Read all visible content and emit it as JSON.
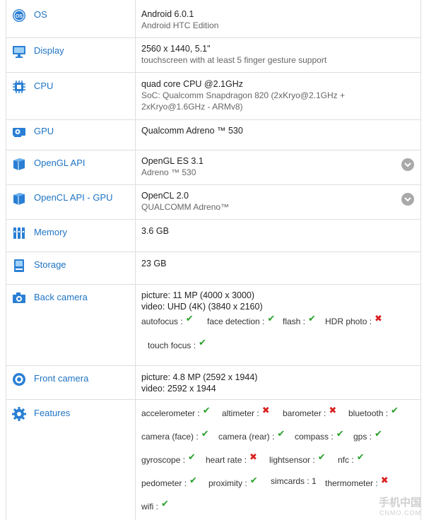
{
  "rows": {
    "os": {
      "label": "OS",
      "line1": "Android 6.0.1",
      "line2": "Android HTC Edition"
    },
    "display": {
      "label": "Display",
      "line1": "2560 x 1440, 5.1\"",
      "line2": "touchscreen with at least 5 finger gesture support"
    },
    "cpu": {
      "label": "CPU",
      "line1": "quad core CPU @2.1GHz",
      "line2": "SoC: Qualcomm Snapdragon 820 (2xKryo@2.1GHz + 2xKryo@1.6GHz - ARMv8)"
    },
    "gpu": {
      "label": "GPU",
      "line1": "Qualcomm Adreno ™ 530"
    },
    "opengl": {
      "label": "OpenGL API",
      "line1": "OpenGL ES 3.1",
      "line2": "Adreno ™ 530"
    },
    "opencl": {
      "label": "OpenCL API - GPU",
      "line1": "OpenCL 2.0",
      "line2": "QUALCOMM Adreno™"
    },
    "memory": {
      "label": "Memory",
      "line1": "3.6 GB"
    },
    "storage": {
      "label": "Storage",
      "line1": "23 GB"
    },
    "back_camera": {
      "label": "Back camera",
      "line1": "picture: 11 MP (4000 x 3000)",
      "line2": "video: UHD (4K) (3840 x 2160)",
      "features": [
        {
          "name": "autofocus :",
          "supported": "yes"
        },
        {
          "name": "face detection :",
          "supported": "yes"
        },
        {
          "name": "flash :",
          "supported": "yes"
        },
        {
          "name": "HDR photo :",
          "supported": "no"
        },
        {
          "name": "touch focus :",
          "supported": "yes"
        }
      ]
    },
    "front_camera": {
      "label": "Front camera",
      "line1": "picture: 4.8 MP (2592 x 1944)",
      "line2": "video: 2592 x 1944"
    },
    "features": {
      "label": "Features",
      "items": [
        {
          "name": "accelerometer :",
          "supported": "yes"
        },
        {
          "name": "altimeter :",
          "supported": "no"
        },
        {
          "name": "barometer :",
          "supported": "no"
        },
        {
          "name": "bluetooth :",
          "supported": "yes"
        },
        {
          "name": "camera (face) :",
          "supported": "yes"
        },
        {
          "name": "camera (rear) :",
          "supported": "yes"
        },
        {
          "name": "compass :",
          "supported": "yes"
        },
        {
          "name": "gps :",
          "supported": "yes"
        },
        {
          "name": "gyroscope :",
          "supported": "yes"
        },
        {
          "name": "heart rate :",
          "supported": "no"
        },
        {
          "name": "lightsensor :",
          "supported": "yes"
        },
        {
          "name": "nfc :",
          "supported": "yes"
        },
        {
          "name": "pedometer :",
          "supported": "yes"
        },
        {
          "name": "proximity :",
          "supported": "yes"
        },
        {
          "name": "simcards : 1"
        },
        {
          "name": "thermometer :",
          "supported": "no"
        },
        {
          "name": "wifi :",
          "supported": "yes"
        }
      ]
    }
  },
  "marks": {
    "yes": "✔",
    "no": "✖"
  },
  "colors": {
    "label": "#1f74c4",
    "icon": "#2a7fd4",
    "yes": "#2aa02a",
    "no": "#d92020",
    "expand": "#a9a9a9"
  },
  "icons": {
    "os": "android-os-icon",
    "display": "monitor-icon",
    "cpu": "cpu-chip-icon",
    "gpu": "graphics-card-icon",
    "opengl": "cube-icon",
    "opencl": "cube-icon",
    "memory": "ram-module-icon",
    "storage": "storage-drive-icon",
    "back_camera": "camera-icon",
    "front_camera": "front-camera-lens-icon",
    "features": "gear-icon"
  },
  "watermark": {
    "line1": "手机中国",
    "line2": "CNMO.COM"
  }
}
